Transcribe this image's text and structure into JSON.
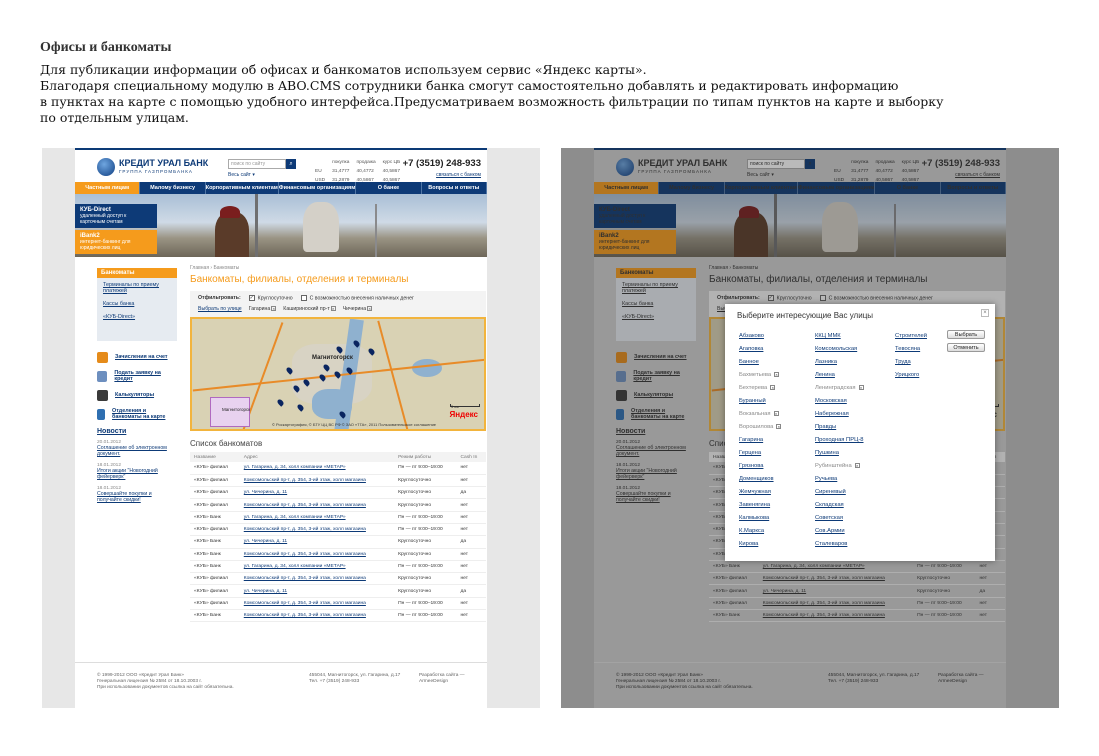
{
  "intro": {
    "title": "Офисы и банкоматы",
    "text": "Для публикации информации об офисах и банкоматов используем сервис «Яндекс карты».\nБлагодаря специальному модулю в ABO.CMS сотрудники банка смогут самостоятельно добавлять и редактировать информацию\nв пунктах на карте с помощью удобного интерфейса.Предусматриваем возможность фильтрации по типам пунктов на карте и выборку\nпо отдельным улицам."
  },
  "site": {
    "logo_name": "КРЕДИТ УРАЛ БАНК",
    "logo_sub": "ГРУППА ГАЗПРОМБАНКА",
    "search_placeholder": "поиск по сайту",
    "search_button": "⌕",
    "all_site": "Весь сайт ▾",
    "rates": {
      "headers": [
        "покупка",
        "продажа",
        "курс ЦБ"
      ],
      "rows": [
        {
          "cur": "EU",
          "buy": "31,4777",
          "sell": "40,4772",
          "cb": "40,5867"
        },
        {
          "cur": "USD",
          "buy": "31,2879",
          "sell": "40,5867",
          "cb": "40,5867"
        }
      ]
    },
    "phone": "+7 (3519) 248-933",
    "contact": "связаться с банком",
    "nav": [
      "Частным лицам",
      "Малому бизнесу",
      "Корпоративным клиентам",
      "Финансовым организациям",
      "О банке",
      "Вопросы и ответы"
    ],
    "promo1": {
      "title": "КУБ-Direct",
      "text": "удаленный доступ к карточным счетам"
    },
    "promo2": {
      "title": "iBank2",
      "text": "интернет-банкинг для юридических лиц"
    },
    "side_title": "Банкоматы",
    "side_items": [
      "Терминалы по приему платежей",
      "Кассы банка",
      "«КУБ-Direct»"
    ],
    "side_links": [
      {
        "label": "Зачисления на счет",
        "icon": "wallet-icon",
        "color": "#e58b1a"
      },
      {
        "label": "Подать заявку на кредит",
        "icon": "document-icon",
        "color": "#6d8fbf"
      },
      {
        "label": "Калькуляторы",
        "icon": "calculator-icon",
        "color": "#3a3a3a"
      },
      {
        "label": "Отделения и банкоматы на карте",
        "icon": "buildings-icon",
        "color": "#2f6fb1"
      }
    ],
    "news_title": "Новости",
    "news": [
      {
        "date": "20.01.2012",
        "text": "Соглашение об электронном документ."
      },
      {
        "date": "18.01.2012",
        "text": "Итоги акции \"Новогодний фейерверк\""
      },
      {
        "date": "18.01.2012",
        "text": "Совершайте покупки и получайте скидки!"
      }
    ],
    "breadcrumb": "Главная › Банкоматы",
    "page_title": "Банкоматы, филиалы, отделения и терминалы",
    "filter": {
      "label": "Отфильтровать:",
      "opt1": "Круглосуточно",
      "opt2": "С возможностью внесения наличных денег",
      "street_link": "Выбрать по улице",
      "tags": [
        "Гагарина",
        "Кашириноский пр-т",
        "Чичерина"
      ]
    },
    "map": {
      "city": "Магнитогорск",
      "inset_label": "Магнитогорск",
      "brand": "Яндекс",
      "scale": "3 км",
      "copyright": "© Роскартография, © БТУ ЦЦ ВС РФ © ЗАО «ТГА», 2011 Пользовательское соглашение"
    },
    "list_title": "Список банкоматов",
    "table_headers": [
      "Название",
      "Адрес",
      "Режим работы",
      "Cash In"
    ],
    "rows": [
      [
        "«КУБ» филиал",
        "ул. Гагарина, д. 34, холл компании «МЕТАР»",
        "Пн — пт 9:00–19:00",
        "нет"
      ],
      [
        "«КУБ» филиал",
        "Комсомольский пр-т, д. 354, 3-ий этаж, холл магазина",
        "Круглосуточно",
        "нет"
      ],
      [
        "«КУБ» филиал",
        "ул. Чичерина, д. 11",
        "Круглосуточно",
        "да"
      ],
      [
        "«КУБ» филиал",
        "Комсомольский пр-т, д. 354, 3-ий этаж, холл магазина",
        "Круглосуточно",
        "нет"
      ],
      [
        "«КУБ» Банк",
        "ул. Гагарина, д. 34, холл компании «МЕТАР»",
        "Пн — пт 9:00–19:00",
        "нет"
      ],
      [
        "«КУБ» филиал",
        "Комсомольский пр-т, д. 354, 3-ий этаж, холл магазина",
        "Пн — пт 9:00–19:00",
        "нет"
      ],
      [
        "«КУБ» Банк",
        "ул. Чичерина, д. 11",
        "Круглосуточно",
        "да"
      ],
      [
        "«КУБ» Банк",
        "Комсомольский пр-т, д. 354, 3-ий этаж, холл магазина",
        "Круглосуточно",
        "нет"
      ],
      [
        "«КУБ» Банк",
        "ул. Гагарина, д. 34, холл компании «МЕТАР»",
        "Пн — пт 9:00–19:00",
        "нет"
      ],
      [
        "«КУБ» филиал",
        "Комсомольский пр-т, д. 354, 3-ий этаж, холл магазина",
        "Круглосуточно",
        "нет"
      ],
      [
        "«КУБ» филиал",
        "ул. Чичерина, д. 11",
        "Круглосуточно",
        "да"
      ],
      [
        "«КУБ» филиал",
        "Комсомольский пр-т, д. 354, 3-ий этаж, холл магазина",
        "Пн — пт 9:00–19:00",
        "нет"
      ],
      [
        "«КУБ» Банк",
        "Комсомольский пр-т, д. 354, 3-ий этаж, холл магазина",
        "Пн — пт 9:00–19:00",
        "нет"
      ]
    ],
    "footer": {
      "c1": "© 1999-2012 ООО «Кредит Урал Банк»\nГенеральная лицензия № 2584 от 18.10.2003 г.\nПри использовании документов ссылка на сайт обязательна.",
      "c2": "455044, Магнитогорск, ул. Гагарина, д.17\nТел. +7 (3519) 248-933",
      "c3": "Разработка сайта —\nArmeeDesign"
    }
  },
  "modal": {
    "title": "Выберите интересующие Вас улицы",
    "close": "×",
    "select_button": "Выбрать",
    "cancel_button": "Отменить",
    "col1": [
      {
        "name": "Абзаково",
        "dis": false
      },
      {
        "name": "Агаповка",
        "dis": false
      },
      {
        "name": "Банное",
        "dis": false
      },
      {
        "name": "Бахметьева",
        "dis": true
      },
      {
        "name": "Бехтерева",
        "dis": true
      },
      {
        "name": "Буранный",
        "dis": false
      },
      {
        "name": "Вокзальная",
        "dis": true
      },
      {
        "name": "Ворошилова",
        "dis": true
      },
      {
        "name": "Гагарина",
        "dis": false
      },
      {
        "name": "Герцена",
        "dis": false
      },
      {
        "name": "Грязнова",
        "dis": false
      },
      {
        "name": "Доменщиков",
        "dis": false
      },
      {
        "name": "Жемчужная",
        "dis": false
      },
      {
        "name": "Завенягина",
        "dis": false
      },
      {
        "name": "Калмыкова",
        "dis": false
      },
      {
        "name": "К.Маркса",
        "dis": false
      },
      {
        "name": "Кирова",
        "dis": false
      }
    ],
    "col2": [
      {
        "name": "ККЦ ММК",
        "dis": false
      },
      {
        "name": "Комсомольская",
        "dis": false
      },
      {
        "name": "Лазника",
        "dis": false
      },
      {
        "name": "Ленина",
        "dis": false
      },
      {
        "name": "Ленинградская",
        "dis": true
      },
      {
        "name": "Московская",
        "dis": false
      },
      {
        "name": "Набережная",
        "dis": false
      },
      {
        "name": "Правды",
        "dis": false
      },
      {
        "name": "Проходная ПРЦ-8",
        "dis": false
      },
      {
        "name": "Пушкина",
        "dis": false
      },
      {
        "name": "Рубинштейна",
        "dis": true
      },
      {
        "name": "Ручьева",
        "dis": false
      },
      {
        "name": "Сиреневый",
        "dis": false
      },
      {
        "name": "Складская",
        "dis": false
      },
      {
        "name": "Советская",
        "dis": false
      },
      {
        "name": "Сов.Армии",
        "dis": false
      },
      {
        "name": "Сталеваров",
        "dis": false
      }
    ],
    "col3": [
      {
        "name": "Строителей",
        "dis": false
      },
      {
        "name": "Тевосяна",
        "dis": false
      },
      {
        "name": "Труда",
        "dis": false
      },
      {
        "name": "Урицкого",
        "dis": false
      }
    ]
  }
}
